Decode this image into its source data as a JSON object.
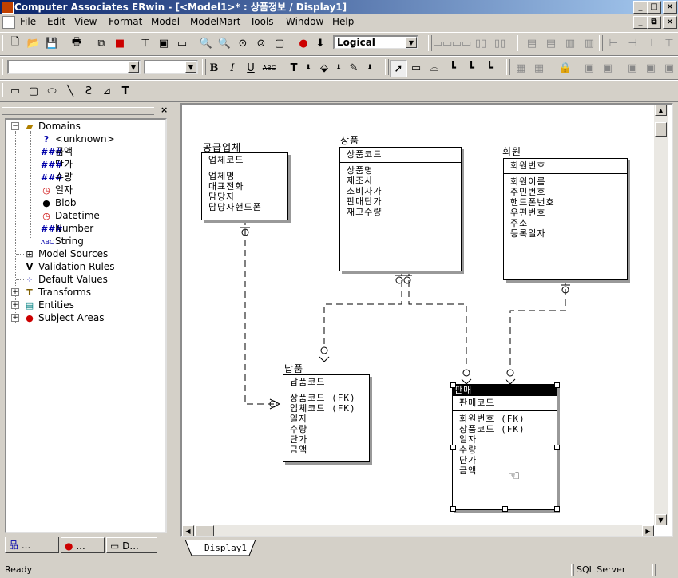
{
  "window": {
    "title": "Computer Associates ERwin - [<Model1>* : 상품정보 / Display1]"
  },
  "menu": [
    "File",
    "Edit",
    "View",
    "Format",
    "Model",
    "ModelMart",
    "Tools",
    "Window",
    "Help"
  ],
  "toolbar": {
    "view_mode": "Logical",
    "font_name": "",
    "font_size": "",
    "bold": "B",
    "italic": "I",
    "underline": "U",
    "strike": "ABC",
    "text_tool": "T"
  },
  "tree": {
    "domains": "Domains",
    "domain_items": [
      "<unknown>",
      "금액",
      "단가",
      "수량",
      "일자",
      "Blob",
      "Datetime",
      "Number",
      "String"
    ],
    "others": [
      "Model Sources",
      "Validation Rules",
      "Default Values",
      "Transforms",
      "Entities",
      "Subject Areas"
    ]
  },
  "panel_tabs": [
    "...",
    "...",
    "D..."
  ],
  "entities": {
    "supplier": {
      "name": "공급업체",
      "pk": "업체코드",
      "attrs": [
        "업체명",
        "대표전화",
        "담당자",
        "담당자핸드폰"
      ]
    },
    "product": {
      "name": "상품",
      "pk": "상품코드",
      "attrs": [
        "상품명",
        "제조사",
        "소비자가",
        "판매단가",
        "재고수량"
      ]
    },
    "member": {
      "name": "회원",
      "pk": "회원번호",
      "attrs": [
        "회원이름",
        "주민번호",
        "핸드폰번호",
        "우편번호",
        "주소",
        "등록일자"
      ]
    },
    "delivery": {
      "name": "납품",
      "pk": "납품코드",
      "attrs": [
        "상품코드 (FK)",
        "업체코드 (FK)",
        "일자",
        "수량",
        "단가",
        "금액"
      ]
    },
    "sale": {
      "name": "판매",
      "pk": "판매코드",
      "attrs": [
        "회원번호 (FK)",
        "상품코드 (FK)",
        "일자",
        "수량",
        "단가",
        "금액"
      ]
    }
  },
  "diagram_tab": "Display1",
  "status": {
    "left": "Ready",
    "right": "SQL Server"
  }
}
